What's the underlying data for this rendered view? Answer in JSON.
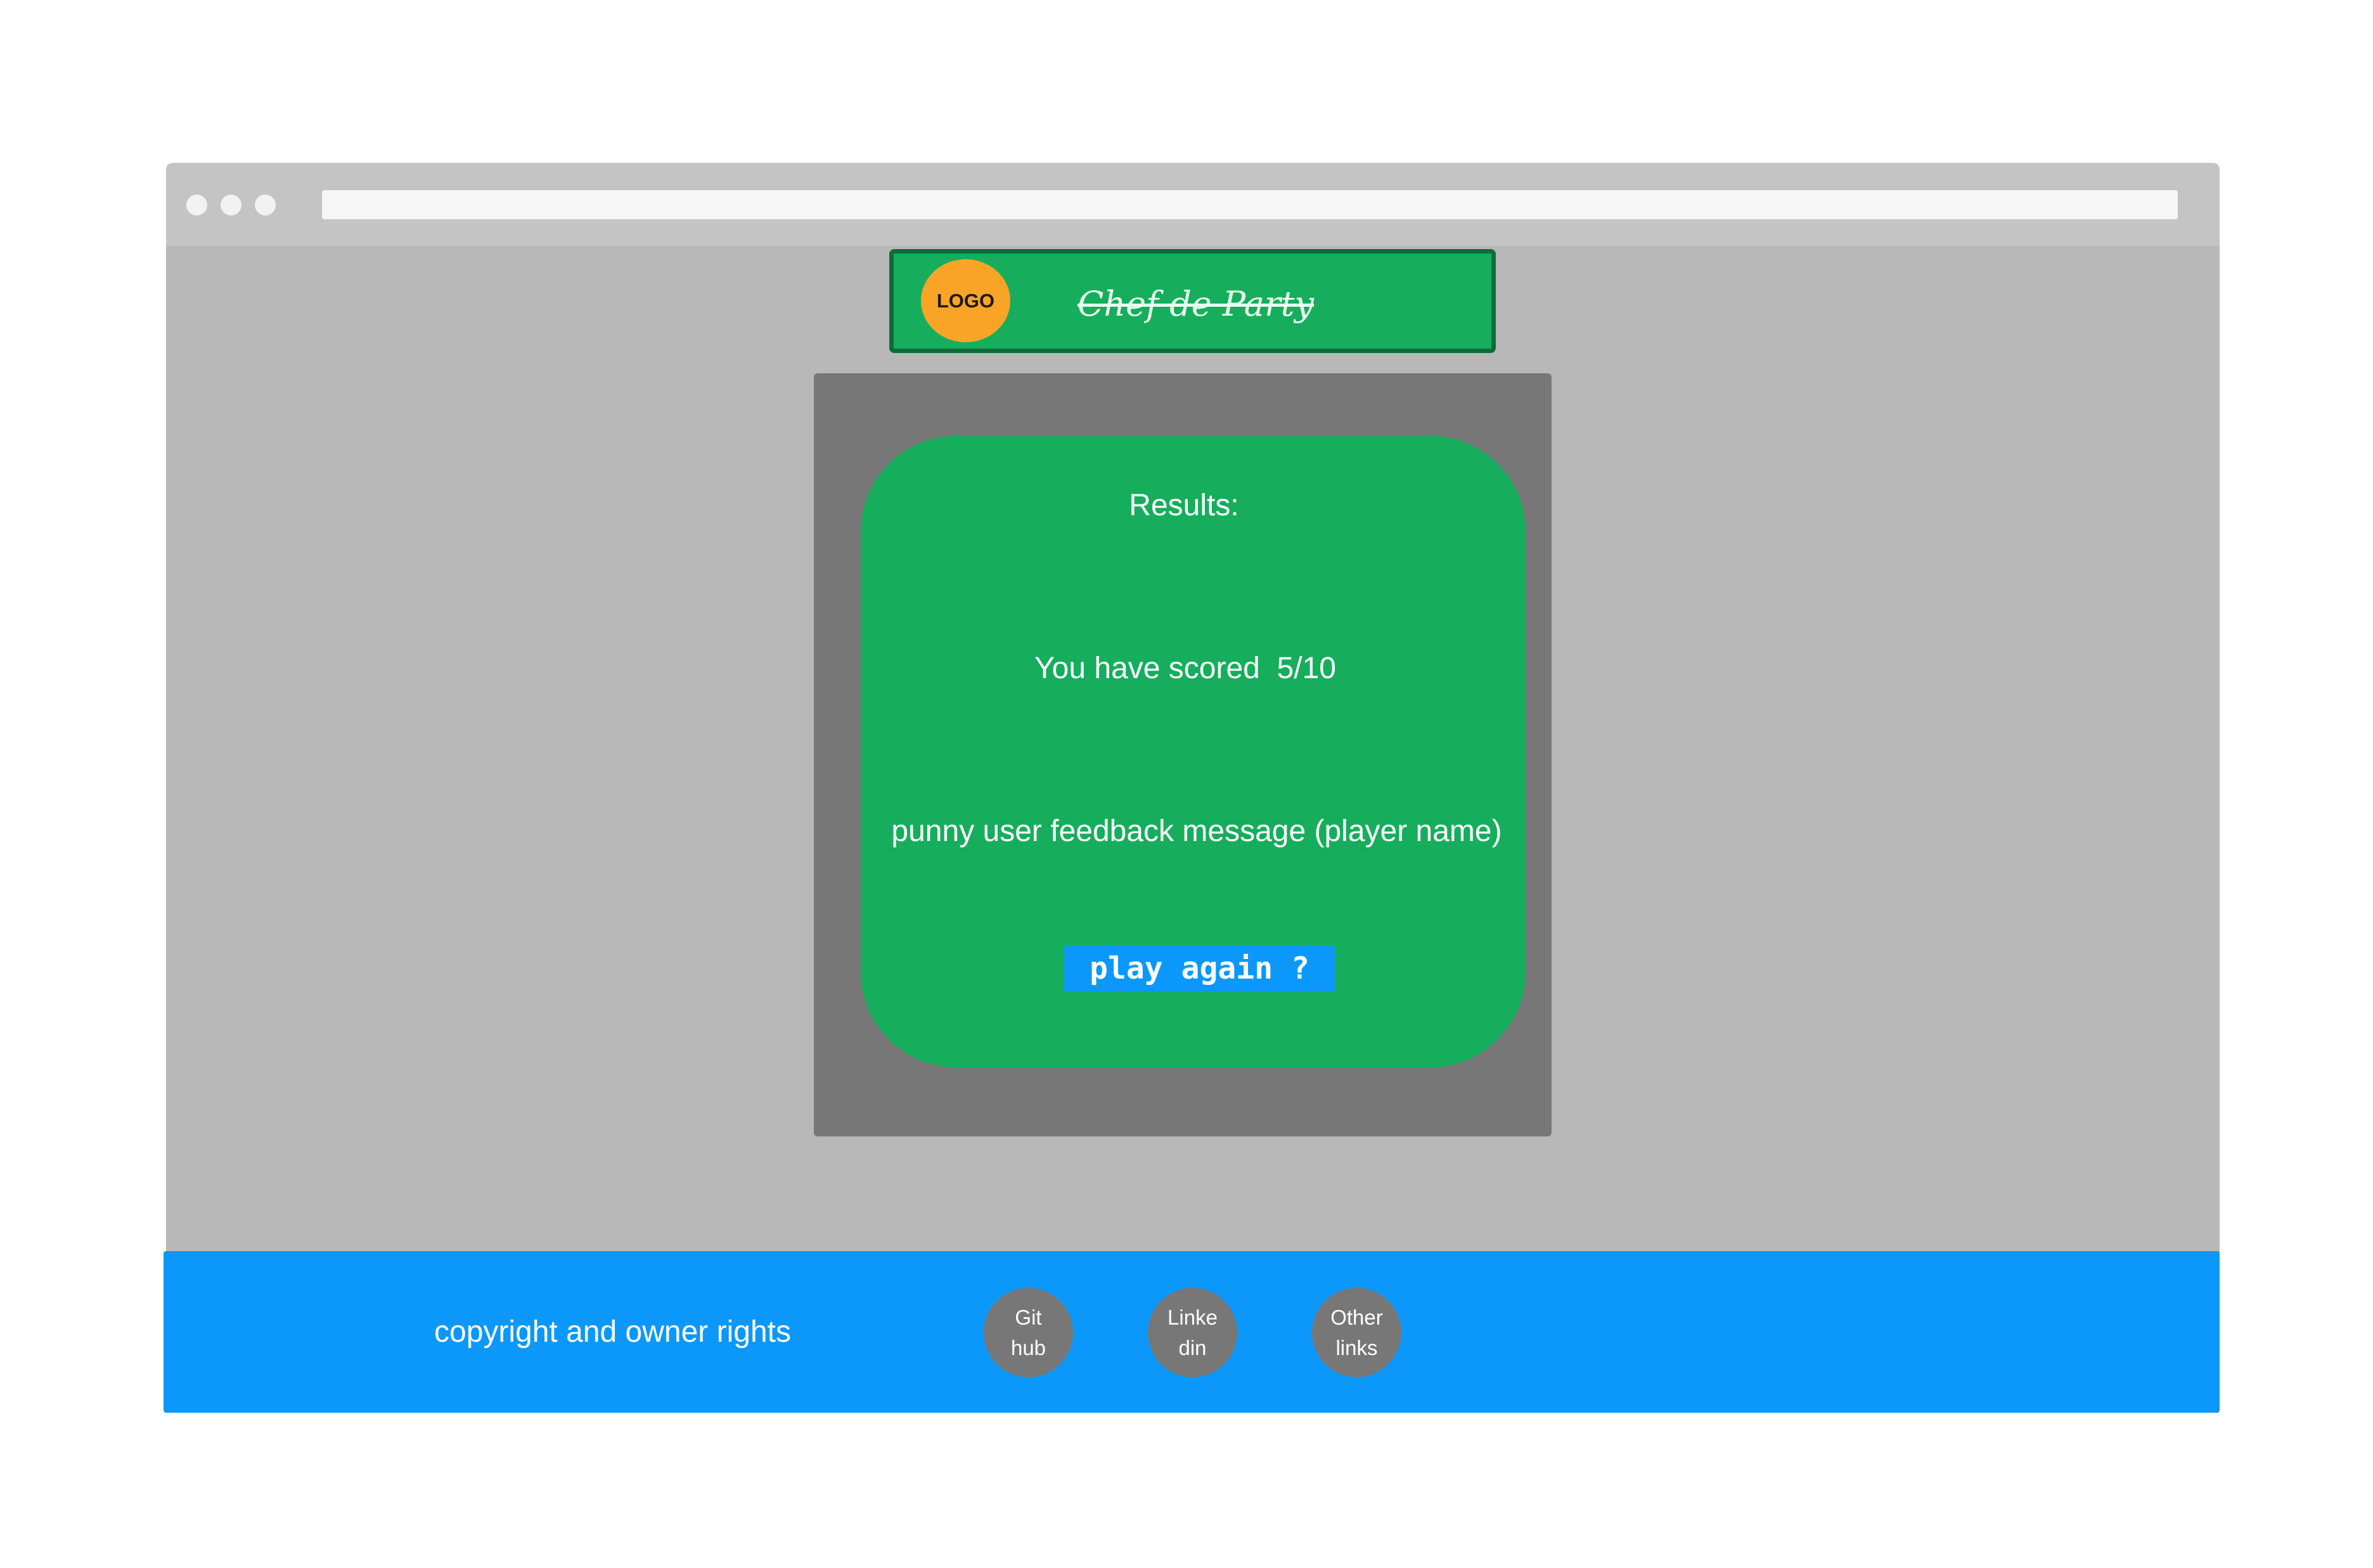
{
  "header": {
    "logo_label": "LOGO",
    "site_title": "Chef de Party"
  },
  "results": {
    "heading": "Results:",
    "score_text": "You have scored  5/10",
    "feedback_message": "punny user feedback message (player name)",
    "play_again_label": "play again ?"
  },
  "footer": {
    "copyright": "copyright and owner rights",
    "links": [
      {
        "line1": "Git",
        "line2": "hub"
      },
      {
        "line1": "Linke",
        "line2": "din"
      },
      {
        "line1": "Other",
        "line2": "links"
      }
    ]
  },
  "colors": {
    "chrome": "#c4c4c4",
    "viewport": "#b8b8b8",
    "brand_green": "#16ae5c",
    "header_border": "#0f6b3a",
    "logo_orange": "#f9a427",
    "panel_gray": "#777777",
    "accent_blue": "#0c98fb"
  }
}
